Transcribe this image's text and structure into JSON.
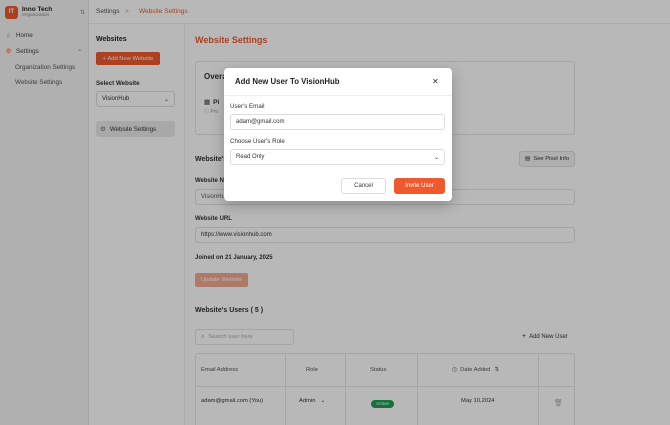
{
  "org": {
    "name": "Inno Tech",
    "subtitle": "Organization",
    "logo_letters": "IT"
  },
  "sidebar": {
    "items": [
      {
        "label": "Home",
        "icon": "home-icon"
      },
      {
        "label": "Settings",
        "icon": "settings-icon"
      }
    ],
    "sub_items": [
      {
        "label": "Organization Settings"
      },
      {
        "label": "Website Settings"
      }
    ]
  },
  "breadcrumb": {
    "parent": "Settings",
    "separator": ">",
    "current": "Website Settings"
  },
  "websites_panel": {
    "title": "Websites",
    "add_button": "+ Add New Website",
    "select_label": "Select Website",
    "selected_website": "VisionHub",
    "menu_item": "Website Settings"
  },
  "main": {
    "title": "Website Settings",
    "overview_title": "Overa",
    "pixel_label": "Pi",
    "pixel_sub": "Pro",
    "details_title": "Website's",
    "pixel_info_button": "See Pixel Info",
    "name_label": "Website Na",
    "name_value": "VisionHub",
    "url_label": "Website URL",
    "url_value": "https://www.visionhub.com",
    "joined": "Joined on 21 January, 2025",
    "update_button": "Update Website",
    "users_title": "Website's Users ( 5 )",
    "search_placeholder": "Search user here",
    "add_user_button": "Add New User"
  },
  "users_table": {
    "headers": [
      "Email Address",
      "Role",
      "Status",
      "Date Added"
    ],
    "rows": [
      {
        "email": "adam@gmail.com (You)",
        "role": "Admin",
        "status": "Active",
        "date": "May 10,2024"
      }
    ]
  },
  "modal": {
    "title": "Add New User To VisionHub",
    "email_label": "User's Email",
    "email_value": "adam@gmail.com",
    "role_label": "Choose User's Role",
    "role_value": "Read Only",
    "cancel_button": "Cancel",
    "invite_button": "Invite User"
  },
  "colors": {
    "accent": "#ee5a2d",
    "active_badge": "#1f9d55",
    "update_disabled": "#f1a88f"
  }
}
